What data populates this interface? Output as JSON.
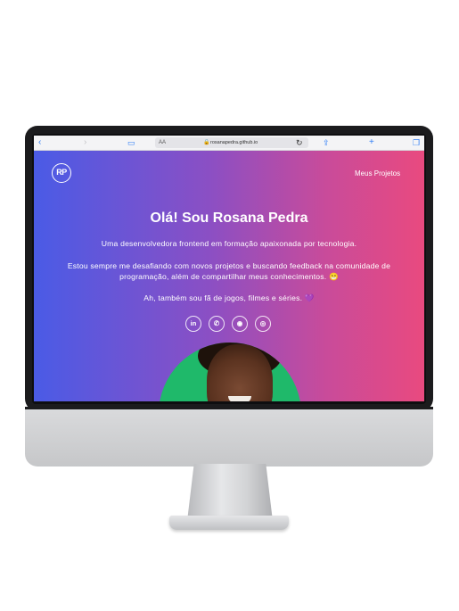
{
  "browser": {
    "url_prefix": "AA",
    "address": "rosanapedra.github.io",
    "icons": [
      "back-icon",
      "forward-icon",
      "bookmarks-icon",
      "lock-icon",
      "reload-icon",
      "share-icon",
      "plus-icon",
      "tabs-icon"
    ]
  },
  "site": {
    "logo": "RP",
    "nav": {
      "projects": "Meus Projetos"
    },
    "title": "Olá! Sou Rosana Pedra",
    "intro": "Uma desenvolvedora frontend em formação apaixonada por tecnologia.",
    "challenge": "Estou sempre me desafiando com novos projetos e buscando feedback na comunidade de programação, além de compartilhar meus conhecimentos. 😁",
    "hobbies": "Ah, também sou fã de jogos, filmes e séries. 💜",
    "socials": [
      {
        "name": "LinkedIn",
        "glyph": "in"
      },
      {
        "name": "WhatsApp",
        "glyph": "✆"
      },
      {
        "name": "GitHub",
        "glyph": "◉"
      },
      {
        "name": "Instagram",
        "glyph": "◎"
      }
    ]
  },
  "colors": {
    "gradient_start": "#4a5be6",
    "gradient_end": "#e94a7f",
    "avatar_bg": "#1fb96a"
  }
}
